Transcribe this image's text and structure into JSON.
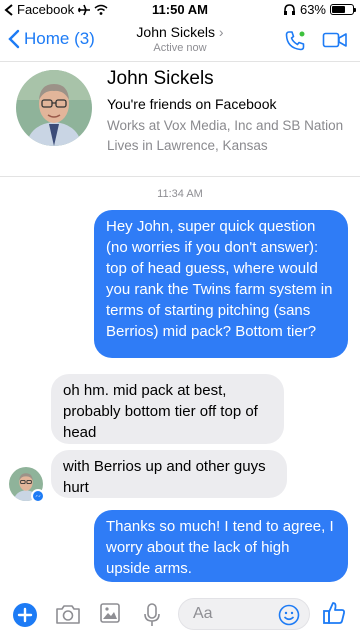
{
  "status_bar": {
    "back_app": "Facebook",
    "time": "11:50 AM",
    "battery_percent": "63%",
    "battery_level": 0.63
  },
  "nav": {
    "back_label": "Home (3)",
    "contact_name": "John Sickels",
    "presence": "Active now",
    "icons": [
      "chevron-left-icon",
      "phone-icon",
      "video-icon"
    ],
    "accent_color": "#1d7bf5"
  },
  "profile": {
    "name": "John Sickels",
    "friends_text": "You're friends on Facebook",
    "work": "Works at Vox Media, Inc and SB Nation",
    "lives": "Lives in Lawrence, Kansas"
  },
  "conversation": {
    "timestamp": "11:34 AM",
    "messages": [
      {
        "from": "me",
        "text": "Hey John, super quick question (no worries if you don't answer): top of head guess, where would you rank the Twins farm system in terms of starting pitching (sans Berrios) mid pack? Bottom tier?"
      },
      {
        "from": "them",
        "text": "oh hm. mid pack at best, probably bottom tier off top of head"
      },
      {
        "from": "them",
        "text": "with Berrios up and other guys hurt"
      },
      {
        "from": "me",
        "text": "Thanks so much! I tend to agree, I worry about the lack of high upside arms."
      }
    ],
    "outgoing_color": "#2f7cf6",
    "incoming_color": "#ececef"
  },
  "composer": {
    "placeholder": "Aa",
    "icons": [
      "plus-icon",
      "camera-icon",
      "image-icon",
      "microphone-icon",
      "emoji-icon",
      "thumbs-up-icon"
    ]
  }
}
